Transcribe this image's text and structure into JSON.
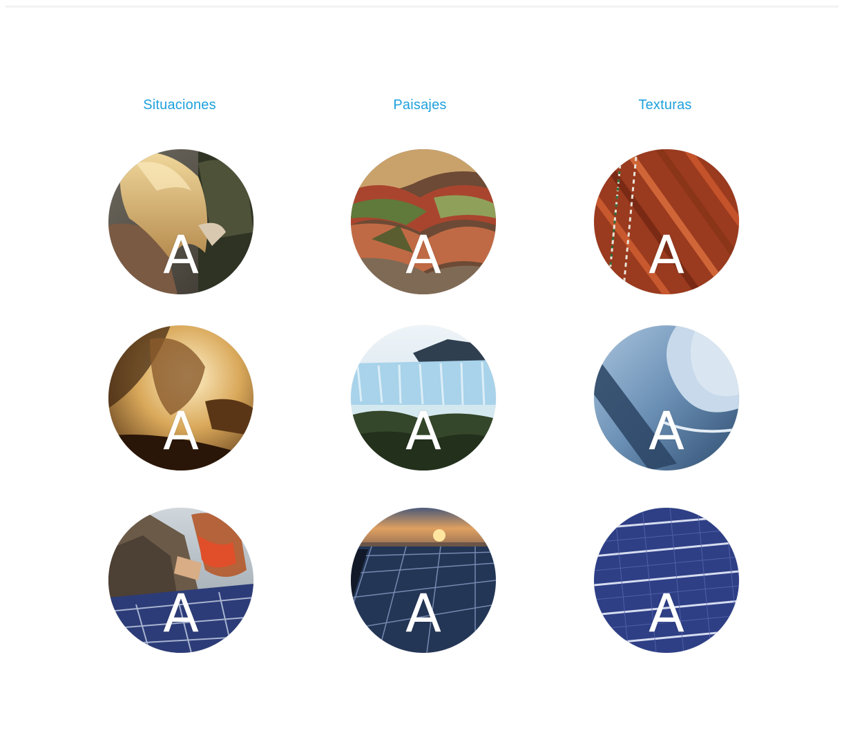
{
  "columns": [
    {
      "title": "Situaciones",
      "items": [
        {
          "scene": "woman-with-blond-hair",
          "letter": "A"
        },
        {
          "scene": "man-driving-sunlight",
          "letter": "A"
        },
        {
          "scene": "worker-installing-solar-panels",
          "letter": "A"
        }
      ]
    },
    {
      "title": "Paisajes",
      "items": [
        {
          "scene": "colorful-mountain-hills",
          "letter": "A"
        },
        {
          "scene": "glacier-landscape",
          "letter": "A"
        },
        {
          "scene": "solar-field-at-sunset",
          "letter": "A"
        }
      ]
    },
    {
      "title": "Texturas",
      "items": [
        {
          "scene": "red-woven-textile",
          "letter": "A"
        },
        {
          "scene": "blue-metallic-curve",
          "letter": "A"
        },
        {
          "scene": "solar-panel-grid",
          "letter": "A"
        }
      ]
    }
  ],
  "colors": {
    "title": "#1ea0dc",
    "letter": "#ffffff",
    "background": "#ffffff"
  }
}
